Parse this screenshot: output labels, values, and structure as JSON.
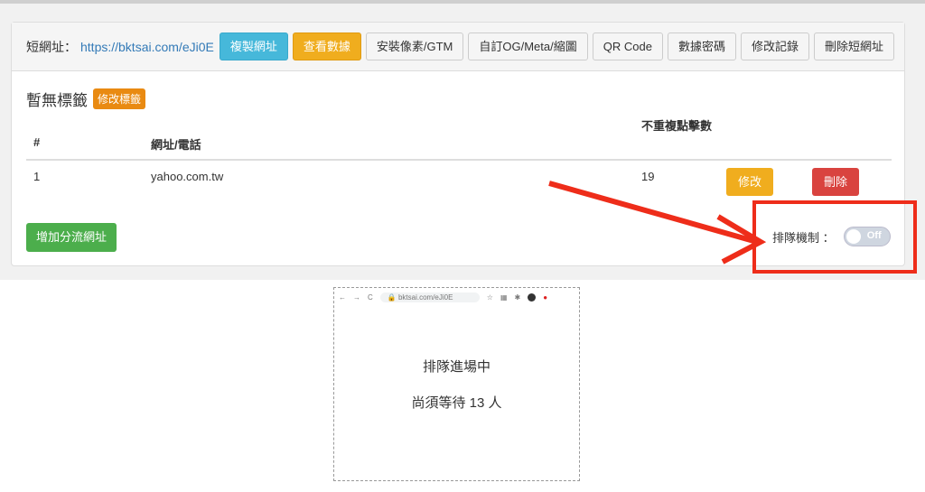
{
  "header": {
    "short_url_label": "短網址：",
    "short_url": "https://bktsai.com/eJi0E",
    "buttons": [
      "複製網址",
      "查看數據",
      "安裝像素/GTM",
      "自訂OG/Meta/縮圖",
      "QR Code",
      "數據密碼",
      "修改記錄",
      "刪除短網址"
    ]
  },
  "tags": {
    "title": "暫無標籤",
    "edit_label": "修改標籤"
  },
  "table": {
    "headers": [
      "#",
      "網址/電話",
      "不重複點擊數"
    ],
    "rows": [
      {
        "index": "1",
        "url": "yahoo.com.tw",
        "clicks": "19",
        "edit": "修改",
        "delete": "刪除"
      }
    ]
  },
  "add_button": "增加分流網址",
  "queue": {
    "label": "排隊機制 ：",
    "toggle": "Off",
    "enabled": false
  },
  "preview": {
    "address": "bktsai.com/eJi0E",
    "title": "排隊進場中",
    "waiting": "尚須等待 13 人"
  },
  "colors": {
    "annotation": "#ee2d1a",
    "info": "#46b8da",
    "warning": "#f0ad1e",
    "danger": "#d9433f",
    "success": "#4cae4c"
  }
}
